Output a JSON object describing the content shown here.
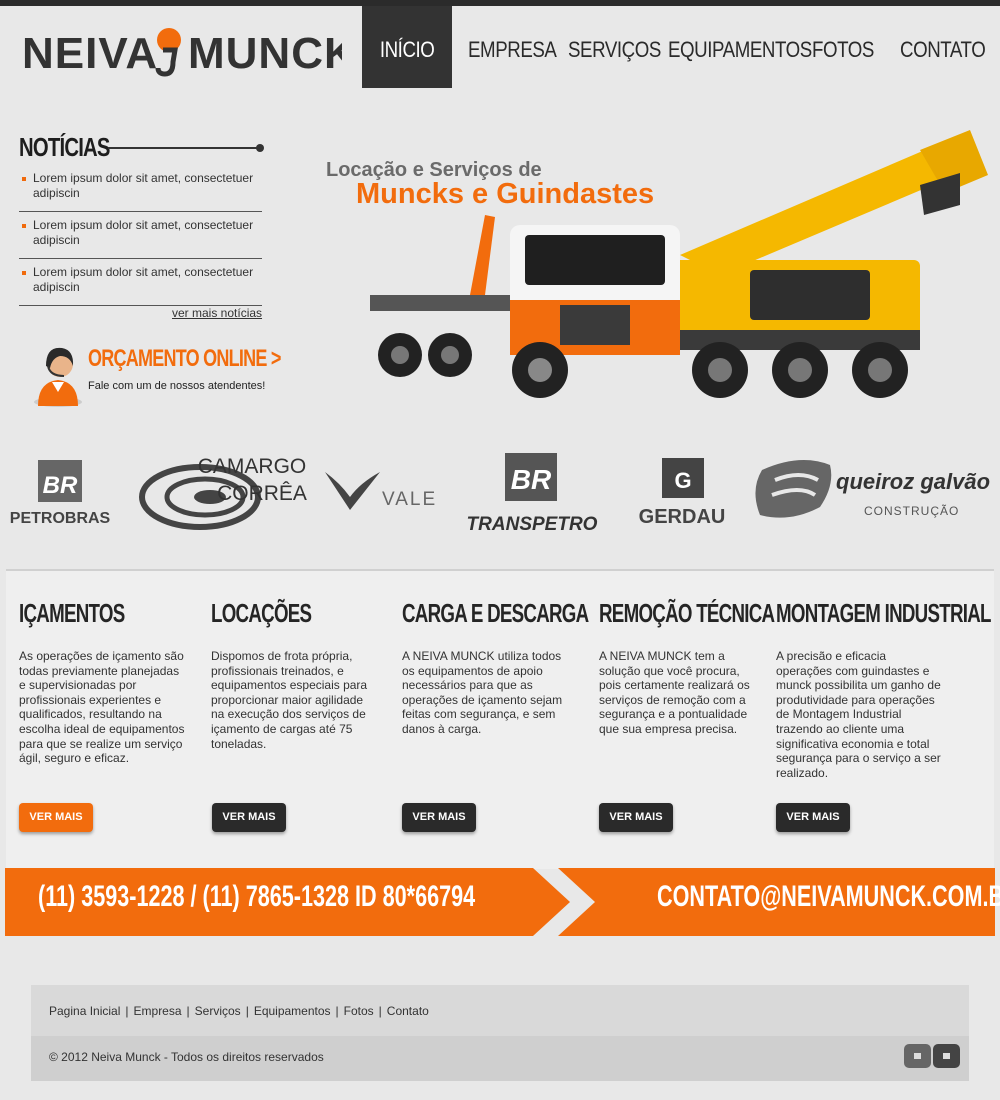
{
  "brand": {
    "name_left": "NEIVA",
    "name_right": "MUNCK"
  },
  "nav": {
    "items": [
      {
        "label": "INÍCIO",
        "active": true
      },
      {
        "label": "EMPRESA"
      },
      {
        "label": "SERVIÇOS"
      },
      {
        "label": "EQUIPAMENTOS"
      },
      {
        "label": "FOTOS"
      },
      {
        "label": "CONTATO"
      }
    ]
  },
  "news": {
    "title": "NOTÍCIAS",
    "items": [
      "Lorem ipsum dolor sit amet, consectetuer adipiscin",
      "Lorem ipsum dolor sit amet, consectetuer adipiscin",
      "Lorem ipsum dolor sit amet, consectetuer adipiscin"
    ],
    "more": "ver mais notícias"
  },
  "quote": {
    "title": "ORÇAMENTO ONLINE >",
    "subtitle": "Fale com um de nossos atendentes!"
  },
  "hero": {
    "line1": "Locação e Serviços de",
    "line2": "Muncks e Guindastes"
  },
  "clients": {
    "petrobras": {
      "badge": "BR",
      "name": "PETROBRAS"
    },
    "camargo": {
      "line1": "CAMARGO",
      "line2": "CORRÊA"
    },
    "vale": {
      "name": "VALE"
    },
    "transpetro": {
      "badge": "BR",
      "name": "TRANSPETRO"
    },
    "gerdau": {
      "badge": "G",
      "name": "GERDAU"
    },
    "queiroz": {
      "name": "queiroz galvão",
      "sub": "CONSTRUÇÃO"
    }
  },
  "services": [
    {
      "title": "IÇAMENTOS",
      "text": "As operações de içamento são todas previamente planejadas e supervisionadas por profissionais experientes e qualificados, resultando na escolha ideal de equipamentos para que se realize um serviço ágil, seguro e eficaz.",
      "button": "VER MAIS"
    },
    {
      "title": "LOCAÇÕES",
      "text": "Dispomos de frota própria, profissionais treinados, e equipamentos especiais para proporcionar maior agilidade na execução dos serviços de içamento de cargas até 75 toneladas.",
      "button": "VER MAIS"
    },
    {
      "title": "CARGA E DESCARGA",
      "text": "A NEIVA MUNCK utiliza todos os equipamentos de apoio necessários para que as operações de içamento sejam feitas com segurança, e sem danos à carga.",
      "button": "VER MAIS"
    },
    {
      "title": "REMOÇÃO TÉCNICA",
      "text": "A NEIVA MUNCK tem a solução que você procura, pois certamente realizará os serviços de remoção com a segurança e a pontualidade que sua empresa precisa.",
      "button": "VER MAIS"
    },
    {
      "title": "MONTAGEM INDUSTRIAL",
      "text": "A precisão e eficacia operações com guindastes e munck possibilita um ganho de produtividade para operações de Montagem Industrial trazendo ao cliente uma significativa economia e total segurança para o serviço a ser realizado.",
      "button": "VER MAIS"
    }
  ],
  "contact": {
    "phones": "(11) 3593-1228   /   (11) 7865-1328   ID 80*66794",
    "email": "CONTATO@NEIVAMUNCK.COM.BR"
  },
  "footer": {
    "links": [
      "Pagina Inicial",
      "Empresa",
      "Serviços",
      "Equipamentos",
      "Fotos",
      "Contato"
    ],
    "copyright": "© 2012 Neiva Munck - Todos os direitos reservados"
  },
  "colors": {
    "accent": "#f26c0d",
    "dark": "#2b2b2b",
    "background": "#e8e8e8"
  }
}
